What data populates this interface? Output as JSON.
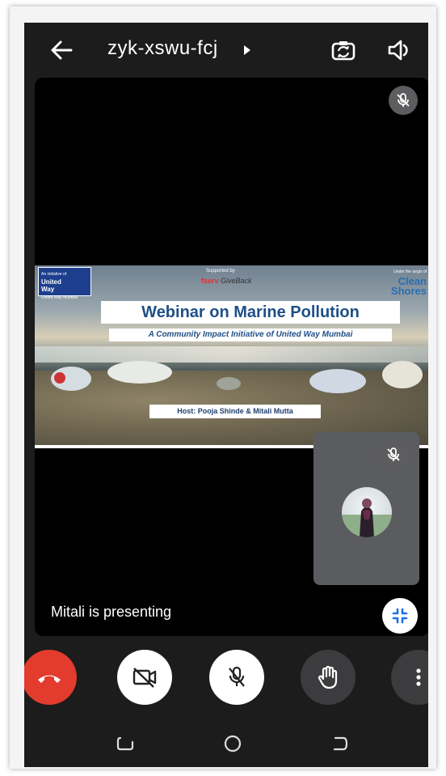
{
  "meeting": {
    "code": "zyk-xswu-fcj",
    "presenting_label": "Mitali is presenting"
  },
  "slide": {
    "org_left_tag": "An initiative of",
    "org_left_name_1": "United",
    "org_left_name_2": "Way",
    "org_left_sub": "United Way Mumbai",
    "supported_by": "Supported by",
    "sponsor": "GiveBack",
    "sponsor_brand": "fserv",
    "org_right_tag": "Under the aegis of",
    "org_right_name_1": "Clean",
    "org_right_name_2": "Shores",
    "title": "Webinar on Marine Pollution",
    "subtitle": "A Community Impact Initiative of  United Way Mumbai",
    "host": "Host:  Pooja Shinde & Mitali Mutta"
  },
  "icons": {
    "back": "arrow-left-icon",
    "title_caret": "caret-right-icon",
    "switch_camera": "camera-switch-icon",
    "speaker": "speaker-icon",
    "mic_off": "mic-off-icon",
    "collapse": "collapse-icon",
    "end_call": "phone-hangup-icon",
    "camera_off": "camera-off-icon",
    "raise_hand": "hand-icon",
    "more": "more-vertical-icon",
    "nav_recent": "recent-apps-icon",
    "nav_home": "home-icon",
    "nav_back": "nav-back-icon"
  },
  "colors": {
    "end_call": "#e33b2e",
    "control_active": "#ffffff",
    "control_dim": "#3c3c3e",
    "background": "#1c1c1c",
    "stage": "#000000",
    "slide_title": "#1f4f87"
  }
}
